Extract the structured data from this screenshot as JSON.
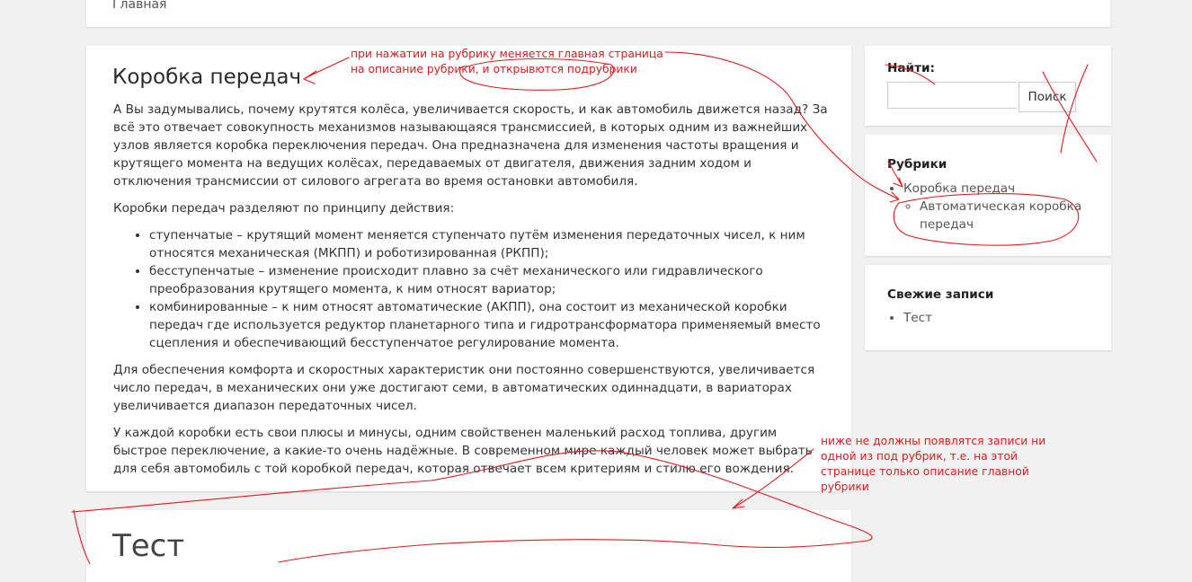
{
  "breadcrumb": {
    "home": "Главная"
  },
  "article": {
    "title": "Коробка передач",
    "paragraphs": [
      "А Вы задумывались, почему крутятся колёса, увеличивается скорость, и как автомобиль движется назад? За всё это отвечает совокупность механизмов называющаяся трансмиссией, в которых одним из важнейших узлов является коробка переключения передач. Она предназначена для изменения частоты вращения и крутящего момента на ведущих колёсах, передаваемых от двигателя, движения задним ходом и отключения трансмиссии от силового агрегата во время остановки автомобиля.",
      "Коробки передач разделяют по принципу действия:"
    ],
    "list": [
      "ступенчатые – крутящий момент меняется ступенчато путём изменения передаточных чисел, к ним относятся механическая (МКПП) и роботизированная (РКПП);",
      "бесступенчатые – изменение происходит плавно за счёт механического или гидравлического преобразования крутящего момента, к ним относят вариатор;",
      "комбинированные – к ним относят автоматические (АКПП), она состоит из механической коробки передач где используется редуктор планетарного типа и гидротрансформатора применяемый вместо сцепления и обеспечивающий бесступенчатое регулирование момента."
    ],
    "paragraphs_after": [
      "Для обеспечения комфорта и скоростных характеристик они постоянно совершенствуются, увеличивается число передач, в механических они уже достигают семи, в автоматических одиннадцати, в вариаторах увеличивается диапазон передаточных чисел.",
      "У каждой коробки есть свои плюсы и минусы, одним свойственен маленький расход топлива, другим быстрое переключение, а какие-то очень надёжные. В современном мире каждый человек может выбрать для себя автомобиль с той коробкой передач, которая отвечает всем критериям и стилю его вождения."
    ]
  },
  "next_post": {
    "title": "Тест"
  },
  "sidebar": {
    "search": {
      "title": "Найти:",
      "value": "",
      "button": "Поиск"
    },
    "categories": {
      "title": "Рубрики",
      "item": "Коробка передач",
      "subitem": "Автоматическая коробка передач"
    },
    "recent": {
      "title": "Свежие записи",
      "item": "Тест"
    }
  },
  "annotations": {
    "top": "при нажатии на рубрику меняется главная страница на описание рубрики, и открывются подрубрики",
    "bottom": "ниже не должны появлятся записи ни одной из под рубрик, т.е. на этой странице только описание главной рубрики"
  },
  "colors": {
    "annotation": "#e01b1b",
    "background": "#f1f1f1",
    "card": "#ffffff"
  }
}
